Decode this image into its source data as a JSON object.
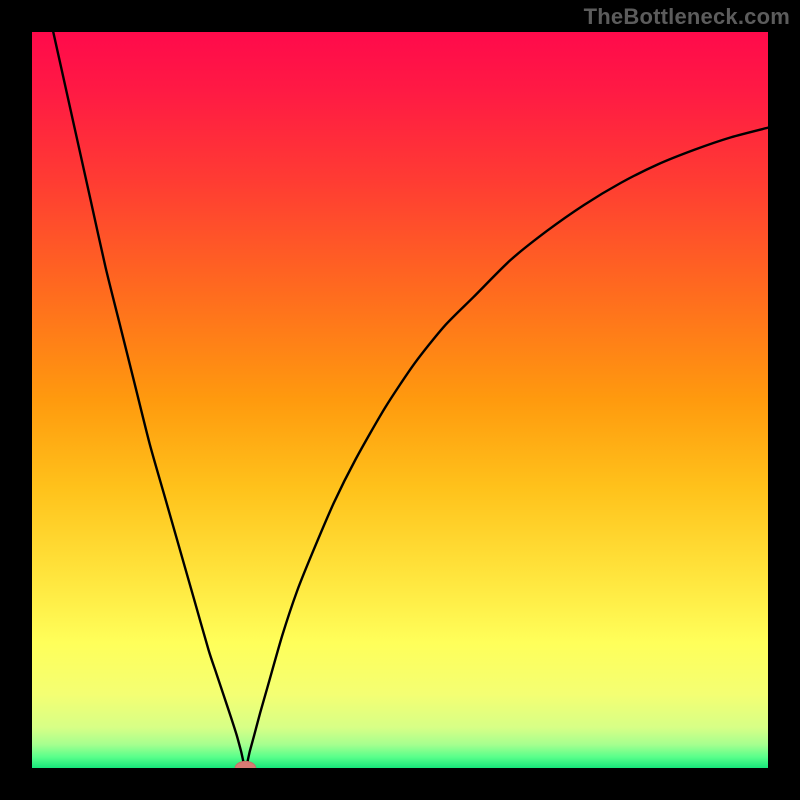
{
  "watermark": "TheBottleneck.com",
  "colors": {
    "frame": "#000000",
    "watermark": "#5c5c5c",
    "curve": "#000000",
    "marker_fill": "#d77b74",
    "marker_stroke": "#c96d67",
    "gradient_stops": [
      {
        "offset": 0.0,
        "color": "#ff0a4b"
      },
      {
        "offset": 0.08,
        "color": "#ff1a44"
      },
      {
        "offset": 0.2,
        "color": "#ff3b33"
      },
      {
        "offset": 0.35,
        "color": "#ff6a1f"
      },
      {
        "offset": 0.5,
        "color": "#ff9a0e"
      },
      {
        "offset": 0.62,
        "color": "#ffc21b"
      },
      {
        "offset": 0.73,
        "color": "#ffe23a"
      },
      {
        "offset": 0.83,
        "color": "#ffff5a"
      },
      {
        "offset": 0.9,
        "color": "#f4ff73"
      },
      {
        "offset": 0.945,
        "color": "#d7ff86"
      },
      {
        "offset": 0.968,
        "color": "#a6ff8f"
      },
      {
        "offset": 0.985,
        "color": "#59ff8b"
      },
      {
        "offset": 1.0,
        "color": "#17e57a"
      }
    ]
  },
  "chart_data": {
    "type": "line",
    "title": "",
    "xlabel": "",
    "ylabel": "",
    "xlim": [
      0,
      100
    ],
    "ylim": [
      0,
      100
    ],
    "grid": false,
    "legend": false,
    "background": "vertical red→yellow→green gradient",
    "description": "V-shaped curve with rounded legs reaching a single minimum; a small marker sits at the minimum.",
    "min_point": {
      "x": 29,
      "y": 0
    },
    "series": [
      {
        "name": "curve",
        "x": [
          0,
          2,
          4,
          6,
          8,
          10,
          12,
          14,
          16,
          18,
          20,
          22,
          24,
          25,
          26,
          27,
          27.8,
          28.4,
          29,
          29.6,
          30.2,
          31,
          32,
          34,
          36,
          38,
          41,
          44,
          48,
          52,
          56,
          60,
          65,
          70,
          75,
          80,
          85,
          90,
          95,
          100
        ],
        "y": [
          113,
          104,
          95,
          86,
          77,
          68,
          60,
          52,
          44,
          37,
          30,
          23,
          16,
          13,
          10,
          7,
          4.5,
          2.3,
          0,
          2.3,
          4.5,
          7.5,
          11,
          18,
          24,
          29,
          36,
          42,
          49,
          55,
          60,
          64,
          69,
          73,
          76.5,
          79.5,
          82,
          84,
          85.7,
          87
        ]
      }
    ],
    "annotations": [
      {
        "type": "marker",
        "shape": "ellipse",
        "x": 29,
        "y": 0,
        "rx": 1.4,
        "ry": 0.9
      }
    ]
  }
}
